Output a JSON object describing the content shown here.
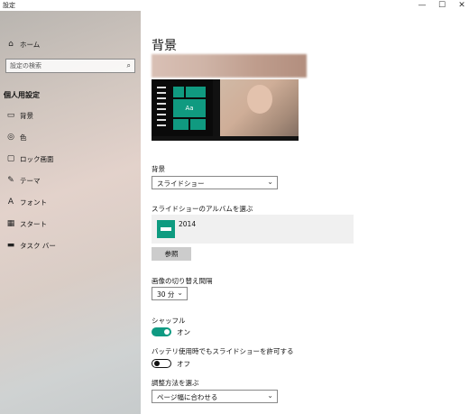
{
  "window": {
    "title": "設定",
    "minimize": "—",
    "maximize": "☐",
    "close": "✕"
  },
  "sidebar": {
    "home": "ホーム",
    "search_placeholder": "設定の検索",
    "section_title": "個人用設定",
    "items": [
      {
        "label": "背景",
        "icon": "background-icon"
      },
      {
        "label": "色",
        "icon": "palette-icon"
      },
      {
        "label": "ロック画面",
        "icon": "lock-screen-icon"
      },
      {
        "label": "テーマ",
        "icon": "theme-icon"
      },
      {
        "label": "フォント",
        "icon": "font-icon"
      },
      {
        "label": "スタート",
        "icon": "start-icon"
      },
      {
        "label": "タスク バー",
        "icon": "taskbar-icon"
      }
    ]
  },
  "main": {
    "title": "背景",
    "preview_tile_text": "Aa",
    "background_label": "背景",
    "background_value": "スライドショー",
    "album_label": "スライドショーのアルバムを選ぶ",
    "album_name": "2014",
    "browse_button": "参照",
    "interval_label": "画像の切り替え間隔",
    "interval_value": "30 分",
    "shuffle_label": "シャッフル",
    "shuffle_state": "オン",
    "battery_label": "バッテリ使用時でもスライドショーを許可する",
    "battery_state": "オフ",
    "fit_label": "調整方法を選ぶ",
    "fit_value": "ページ幅に合わせる"
  },
  "colors": {
    "accent": "#0f9a82"
  }
}
